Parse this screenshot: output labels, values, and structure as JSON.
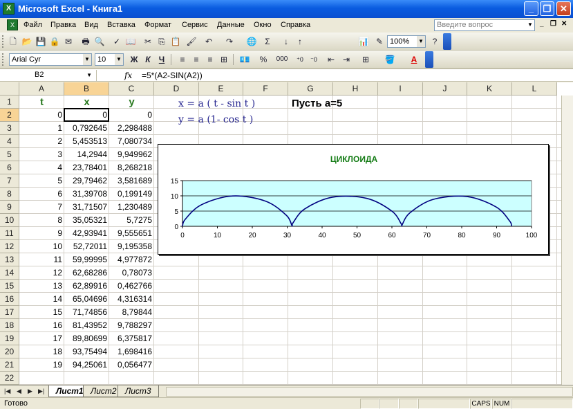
{
  "window": {
    "title": "Microsoft Excel - Книга1",
    "app_icon": "excel-icon"
  },
  "menu": [
    "Файл",
    "Правка",
    "Вид",
    "Вставка",
    "Формат",
    "Сервис",
    "Данные",
    "Окно",
    "Справка"
  ],
  "ask_placeholder": "Введите вопрос",
  "toolbar": {
    "zoom": "100%",
    "font_name": "Arial Cyr",
    "font_size": "10",
    "bold": "Ж",
    "italic": "К",
    "underline": "Ч",
    "currency": "%",
    "thousands": "000"
  },
  "formula_bar": {
    "name_box": "B2",
    "fx": "fx",
    "formula": "=5*(A2-SIN(A2))"
  },
  "columns": [
    "A",
    "B",
    "C",
    "D",
    "E",
    "F",
    "G",
    "H",
    "I",
    "J",
    "K",
    "L"
  ],
  "rows": [
    "1",
    "2",
    "3",
    "4",
    "5",
    "6",
    "7",
    "8",
    "9",
    "10",
    "11",
    "12",
    "13",
    "14",
    "15",
    "16",
    "17",
    "18",
    "19",
    "20",
    "21",
    "22",
    "23"
  ],
  "header_cells": {
    "A1": "t",
    "B1": "x",
    "C1": "y"
  },
  "formulas_text": {
    "x": "x = a ( t - sin t )",
    "y": "y = a (1-  cos t )"
  },
  "let_text": "Пусть а=5",
  "table": [
    [
      "0",
      "0",
      "0"
    ],
    [
      "1",
      "0,792645",
      "2,298488"
    ],
    [
      "2",
      "5,453513",
      "7,080734"
    ],
    [
      "3",
      "14,2944",
      "9,949962"
    ],
    [
      "4",
      "23,78401",
      "8,268218"
    ],
    [
      "5",
      "29,79462",
      "3,581689"
    ],
    [
      "6",
      "31,39708",
      "0,199149"
    ],
    [
      "7",
      "31,71507",
      "1,230489"
    ],
    [
      "8",
      "35,05321",
      "5,7275"
    ],
    [
      "9",
      "42,93941",
      "9,555651"
    ],
    [
      "10",
      "52,72011",
      "9,195358"
    ],
    [
      "11",
      "59,99995",
      "4,977872"
    ],
    [
      "12",
      "62,68286",
      "0,78073"
    ],
    [
      "13",
      "62,89916",
      "0,462766"
    ],
    [
      "14",
      "65,04696",
      "4,316314"
    ],
    [
      "15",
      "71,74856",
      "8,79844"
    ],
    [
      "16",
      "81,43952",
      "9,788297"
    ],
    [
      "17",
      "89,80699",
      "6,375817"
    ],
    [
      "18",
      "93,75494",
      "1,698416"
    ],
    [
      "19",
      "94,25061",
      "0,056477"
    ]
  ],
  "chart_data": {
    "type": "line",
    "title": "ЦИКЛОИДА",
    "xlim": [
      0,
      100
    ],
    "ylim": [
      0,
      15
    ],
    "x_ticks": [
      0,
      10,
      20,
      30,
      40,
      50,
      60,
      70,
      80,
      90,
      100
    ],
    "y_ticks": [
      0,
      5,
      10,
      15
    ],
    "plot_bg": "#ccffff",
    "line_color": "#000080",
    "grid": "horizontal",
    "series": [
      {
        "points": [
          [
            0,
            0
          ],
          [
            0.792645,
            2.298488
          ],
          [
            5.453513,
            7.080734
          ],
          [
            14.2944,
            9.949962
          ],
          [
            23.78401,
            8.268218
          ],
          [
            29.79462,
            3.581689
          ],
          [
            31.39708,
            0.199149
          ],
          [
            31.71507,
            1.230489
          ],
          [
            35.05321,
            5.7275
          ],
          [
            42.93941,
            9.555651
          ],
          [
            52.72011,
            9.195358
          ],
          [
            59.99995,
            4.977872
          ],
          [
            62.68286,
            0.78073
          ],
          [
            62.89916,
            0.462766
          ],
          [
            65.04696,
            4.316314
          ],
          [
            71.74856,
            8.79844
          ],
          [
            81.43952,
            9.788297
          ],
          [
            89.80699,
            6.375817
          ],
          [
            93.75494,
            1.698416
          ],
          [
            94.25061,
            0.056477
          ]
        ]
      }
    ]
  },
  "sheets": [
    "Лист1",
    "Лист2",
    "Лист3"
  ],
  "status": {
    "ready": "Готово",
    "caps": "CAPS",
    "num": "NUM"
  }
}
